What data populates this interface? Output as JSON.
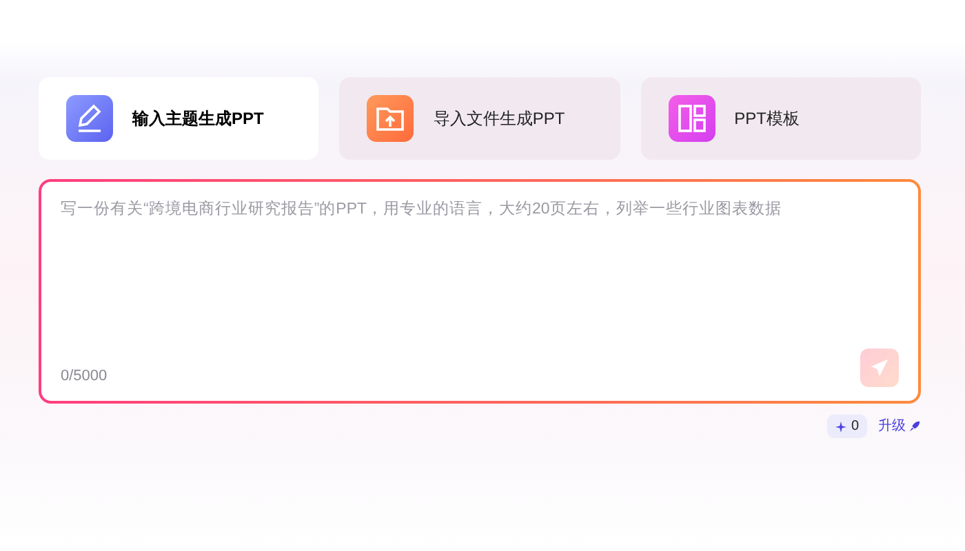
{
  "tabs": [
    {
      "label": "输入主题生成PPT",
      "kind": "pen",
      "selected": true
    },
    {
      "label": "导入文件生成PPT",
      "kind": "upload",
      "selected": false
    },
    {
      "label": "PPT模板",
      "kind": "template",
      "selected": false
    }
  ],
  "prompt": {
    "placeholder": "写一份有关“跨境电商行业研究报告”的PPT，用专业的语言，大约20页左右，列举一些行业图表数据",
    "counter": "0/5000",
    "send_disabled": true
  },
  "credits": "0",
  "upgrade": "升级"
}
